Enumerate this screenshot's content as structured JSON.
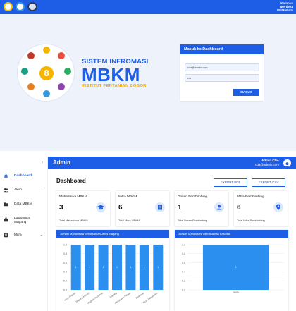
{
  "login_page": {
    "header": {
      "badge_line1": "Kampus",
      "badge_line2": "Merdeka",
      "badge_line3": "INDONESIA JAYA"
    },
    "emblem_number": "8",
    "brand": {
      "top": "SISTEM INFROMASI",
      "main": "MBKM",
      "sub": "INSTITUT PERTANIAN BOGOR"
    },
    "login_card": {
      "title": "Masuk ke Dashboard",
      "email_value": "cda@admin.com",
      "password_value": "••••",
      "submit_label": "MASUK"
    }
  },
  "dashboard": {
    "topbar": {
      "title": "Admin",
      "user_name": "Admin CDA",
      "user_email": "cda@admin.com"
    },
    "sidebar": {
      "collapse_icon": "chevron-left-icon",
      "items": [
        {
          "label": "Dashboard",
          "icon": "home-icon",
          "active": true,
          "has_submenu": false
        },
        {
          "label": "Akun",
          "icon": "users-icon",
          "active": false,
          "has_submenu": true
        },
        {
          "label": "Data MBKM",
          "icon": "folder-icon",
          "active": false,
          "has_submenu": false
        },
        {
          "label": "Lowongan Magang",
          "icon": "briefcase-icon",
          "active": false,
          "has_submenu": false
        },
        {
          "label": "Mitra",
          "icon": "building-icon",
          "active": false,
          "has_submenu": true
        }
      ]
    },
    "page_title": "Dashboard",
    "export_pdf_label": "EXPORT PDF",
    "export_csv_label": "EXPORT CSV",
    "stats": [
      {
        "title": "Mahasiswa MBKM",
        "value": "3",
        "subtitle": "Total Mahasiswa MBKM",
        "icon": "graduation-cap-icon"
      },
      {
        "title": "Mitra MBKM",
        "value": "6",
        "subtitle": "Total Mitra MBKM",
        "icon": "building-icon"
      },
      {
        "title": "Dosen Pembimbing",
        "value": "1",
        "subtitle": "Total Dosen Pembimbing",
        "icon": "user-icon"
      },
      {
        "title": "Mitra Pembimbing",
        "value": "6",
        "subtitle": "Total Mitra Pembimbing",
        "icon": "location-pin-icon"
      }
    ],
    "colors": {
      "primary": "#1e5ee6",
      "bar": "#2b8ff0",
      "accent": "#f0a500"
    }
  },
  "chart_data": [
    {
      "type": "bar",
      "title": "Jumlah Mahasiswa Berdasarkan Jenis Magang",
      "categories": [
        "Kerja Praktek",
        "Magang Industri",
        "Magang Penelitian",
        "Magang",
        "Pertukaran Pelajar",
        "Penelitian",
        "Studi Independen"
      ],
      "values": [
        1,
        1,
        1,
        1,
        1,
        1,
        1
      ],
      "data_labels": [
        "1",
        "1",
        "1",
        "1",
        "1",
        "1",
        "1"
      ],
      "ylim": [
        0,
        1.0
      ],
      "yticks": [
        "1.0",
        "0.8",
        "0.6",
        "0.4",
        "0.2",
        "0.0"
      ],
      "grid": true
    },
    {
      "type": "bar",
      "title": "Jumlah Mahasiswa Berdasarkan Fakultas",
      "categories": [
        "FMIPA"
      ],
      "values": [
        3
      ],
      "data_labels": [
        "3"
      ],
      "ylim": [
        0,
        1.0
      ],
      "yticks": [
        "1.0",
        "0.8",
        "0.6",
        "0.4",
        "0.2",
        "0.0"
      ],
      "grid": true
    }
  ]
}
